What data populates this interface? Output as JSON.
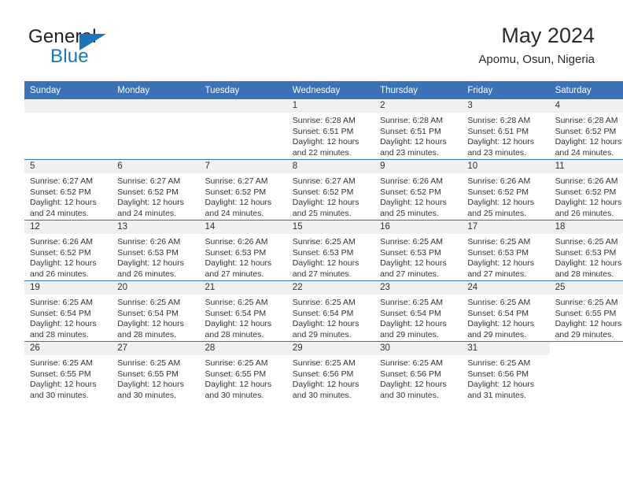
{
  "brand": {
    "name_top": "General",
    "name_bottom": "Blue",
    "triangle_icon": "triangle-icon",
    "accent_color": "#1b75bb"
  },
  "header": {
    "title": "May 2024",
    "location": "Apomu, Osun, Nigeria",
    "header_bg_color": "#3a72b8",
    "daynum_strip_color": "#f0f0f0"
  },
  "weekday_headers": [
    "Sunday",
    "Monday",
    "Tuesday",
    "Wednesday",
    "Thursday",
    "Friday",
    "Saturday"
  ],
  "weeks": [
    [
      {
        "day": "",
        "type": "empty",
        "lines": []
      },
      {
        "day": "",
        "type": "empty",
        "lines": []
      },
      {
        "day": "",
        "type": "empty",
        "lines": []
      },
      {
        "day": "1",
        "type": "day",
        "lines": [
          "Sunrise: 6:28 AM",
          "Sunset: 6:51 PM",
          "Daylight: 12 hours",
          "and 22 minutes."
        ]
      },
      {
        "day": "2",
        "type": "day",
        "lines": [
          "Sunrise: 6:28 AM",
          "Sunset: 6:51 PM",
          "Daylight: 12 hours",
          "and 23 minutes."
        ]
      },
      {
        "day": "3",
        "type": "day",
        "lines": [
          "Sunrise: 6:28 AM",
          "Sunset: 6:51 PM",
          "Daylight: 12 hours",
          "and 23 minutes."
        ]
      },
      {
        "day": "4",
        "type": "day",
        "lines": [
          "Sunrise: 6:28 AM",
          "Sunset: 6:52 PM",
          "Daylight: 12 hours",
          "and 24 minutes."
        ]
      }
    ],
    [
      {
        "day": "5",
        "type": "day",
        "lines": [
          "Sunrise: 6:27 AM",
          "Sunset: 6:52 PM",
          "Daylight: 12 hours",
          "and 24 minutes."
        ]
      },
      {
        "day": "6",
        "type": "day",
        "lines": [
          "Sunrise: 6:27 AM",
          "Sunset: 6:52 PM",
          "Daylight: 12 hours",
          "and 24 minutes."
        ]
      },
      {
        "day": "7",
        "type": "day",
        "lines": [
          "Sunrise: 6:27 AM",
          "Sunset: 6:52 PM",
          "Daylight: 12 hours",
          "and 24 minutes."
        ]
      },
      {
        "day": "8",
        "type": "day",
        "lines": [
          "Sunrise: 6:27 AM",
          "Sunset: 6:52 PM",
          "Daylight: 12 hours",
          "and 25 minutes."
        ]
      },
      {
        "day": "9",
        "type": "day",
        "lines": [
          "Sunrise: 6:26 AM",
          "Sunset: 6:52 PM",
          "Daylight: 12 hours",
          "and 25 minutes."
        ]
      },
      {
        "day": "10",
        "type": "day",
        "lines": [
          "Sunrise: 6:26 AM",
          "Sunset: 6:52 PM",
          "Daylight: 12 hours",
          "and 25 minutes."
        ]
      },
      {
        "day": "11",
        "type": "day",
        "lines": [
          "Sunrise: 6:26 AM",
          "Sunset: 6:52 PM",
          "Daylight: 12 hours",
          "and 26 minutes."
        ]
      }
    ],
    [
      {
        "day": "12",
        "type": "day",
        "lines": [
          "Sunrise: 6:26 AM",
          "Sunset: 6:52 PM",
          "Daylight: 12 hours",
          "and 26 minutes."
        ]
      },
      {
        "day": "13",
        "type": "day",
        "lines": [
          "Sunrise: 6:26 AM",
          "Sunset: 6:53 PM",
          "Daylight: 12 hours",
          "and 26 minutes."
        ]
      },
      {
        "day": "14",
        "type": "day",
        "lines": [
          "Sunrise: 6:26 AM",
          "Sunset: 6:53 PM",
          "Daylight: 12 hours",
          "and 27 minutes."
        ]
      },
      {
        "day": "15",
        "type": "day",
        "lines": [
          "Sunrise: 6:25 AM",
          "Sunset: 6:53 PM",
          "Daylight: 12 hours",
          "and 27 minutes."
        ]
      },
      {
        "day": "16",
        "type": "day",
        "lines": [
          "Sunrise: 6:25 AM",
          "Sunset: 6:53 PM",
          "Daylight: 12 hours",
          "and 27 minutes."
        ]
      },
      {
        "day": "17",
        "type": "day",
        "lines": [
          "Sunrise: 6:25 AM",
          "Sunset: 6:53 PM",
          "Daylight: 12 hours",
          "and 27 minutes."
        ]
      },
      {
        "day": "18",
        "type": "day",
        "lines": [
          "Sunrise: 6:25 AM",
          "Sunset: 6:53 PM",
          "Daylight: 12 hours",
          "and 28 minutes."
        ]
      }
    ],
    [
      {
        "day": "19",
        "type": "day",
        "lines": [
          "Sunrise: 6:25 AM",
          "Sunset: 6:54 PM",
          "Daylight: 12 hours",
          "and 28 minutes."
        ]
      },
      {
        "day": "20",
        "type": "day",
        "lines": [
          "Sunrise: 6:25 AM",
          "Sunset: 6:54 PM",
          "Daylight: 12 hours",
          "and 28 minutes."
        ]
      },
      {
        "day": "21",
        "type": "day",
        "lines": [
          "Sunrise: 6:25 AM",
          "Sunset: 6:54 PM",
          "Daylight: 12 hours",
          "and 28 minutes."
        ]
      },
      {
        "day": "22",
        "type": "day",
        "lines": [
          "Sunrise: 6:25 AM",
          "Sunset: 6:54 PM",
          "Daylight: 12 hours",
          "and 29 minutes."
        ]
      },
      {
        "day": "23",
        "type": "day",
        "lines": [
          "Sunrise: 6:25 AM",
          "Sunset: 6:54 PM",
          "Daylight: 12 hours",
          "and 29 minutes."
        ]
      },
      {
        "day": "24",
        "type": "day",
        "lines": [
          "Sunrise: 6:25 AM",
          "Sunset: 6:54 PM",
          "Daylight: 12 hours",
          "and 29 minutes."
        ]
      },
      {
        "day": "25",
        "type": "day",
        "lines": [
          "Sunrise: 6:25 AM",
          "Sunset: 6:55 PM",
          "Daylight: 12 hours",
          "and 29 minutes."
        ]
      }
    ],
    [
      {
        "day": "26",
        "type": "day",
        "lines": [
          "Sunrise: 6:25 AM",
          "Sunset: 6:55 PM",
          "Daylight: 12 hours",
          "and 30 minutes."
        ]
      },
      {
        "day": "27",
        "type": "day",
        "lines": [
          "Sunrise: 6:25 AM",
          "Sunset: 6:55 PM",
          "Daylight: 12 hours",
          "and 30 minutes."
        ]
      },
      {
        "day": "28",
        "type": "day",
        "lines": [
          "Sunrise: 6:25 AM",
          "Sunset: 6:55 PM",
          "Daylight: 12 hours",
          "and 30 minutes."
        ]
      },
      {
        "day": "29",
        "type": "day",
        "lines": [
          "Sunrise: 6:25 AM",
          "Sunset: 6:56 PM",
          "Daylight: 12 hours",
          "and 30 minutes."
        ]
      },
      {
        "day": "30",
        "type": "day",
        "lines": [
          "Sunrise: 6:25 AM",
          "Sunset: 6:56 PM",
          "Daylight: 12 hours",
          "and 30 minutes."
        ]
      },
      {
        "day": "31",
        "type": "day",
        "lines": [
          "Sunrise: 6:25 AM",
          "Sunset: 6:56 PM",
          "Daylight: 12 hours",
          "and 31 minutes."
        ]
      },
      {
        "day": "",
        "type": "void",
        "lines": []
      }
    ]
  ]
}
